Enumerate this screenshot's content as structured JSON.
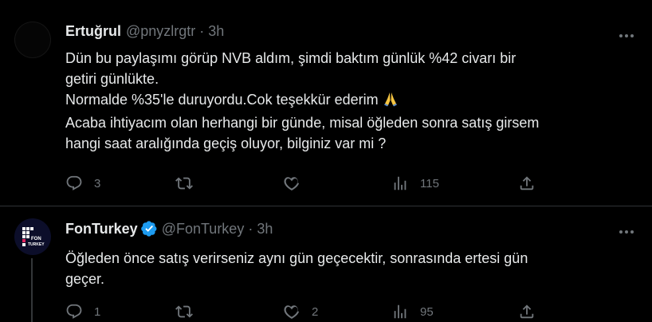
{
  "tweets": [
    {
      "author": "Ertuğrul",
      "handle": "@pnyzlrgtr",
      "dot": "·",
      "time": "3h",
      "lines": [
        "Dün bu paylaşımı görüp NVB aldım, şimdi baktım günlük %42 civarı bir",
        "getiri günlükte.",
        "Normalde %35'le duruyordu.Cok teşekkür ederim",
        "Acaba ihtiyacım olan herhangi bir günde, misal öğleden sonra satış girsem",
        "hangi saat aralığında geçiş oluyor, bilginiz var mi ?"
      ],
      "emoji": "folded-hands",
      "replies": "3",
      "retweets": "",
      "likes": "",
      "views": "115"
    },
    {
      "author": "FonTurkey",
      "handle": "@FonTurkey",
      "dot": "·",
      "time": "3h",
      "verified": true,
      "avatar_text": [
        "FON",
        "TURKEY"
      ],
      "lines": [
        "Öğleden önce satış verirseniz aynı gün geçecektir, sonrasında ertesi gün",
        "geçer."
      ],
      "replies": "1",
      "retweets": "",
      "likes": "2",
      "views": "95"
    }
  ],
  "colors": {
    "background": "#000000",
    "text": "#e7e9ea",
    "muted": "#71767b",
    "verified": "#1d9bf0",
    "border": "#2f3336"
  }
}
